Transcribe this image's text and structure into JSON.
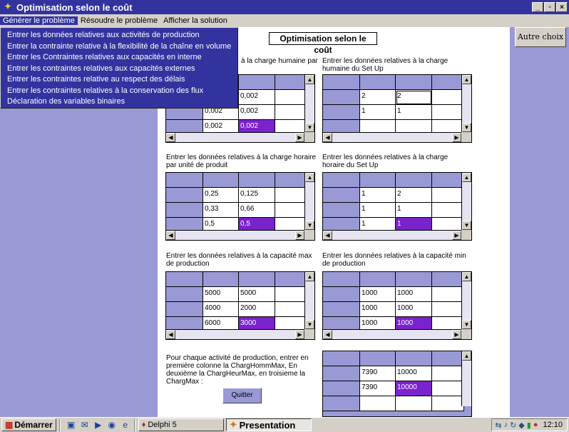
{
  "window": {
    "title": "Optimisation selon le coût"
  },
  "menu": {
    "items": [
      "Générer le problème",
      "Résoudre le problème",
      "Afficher la solution"
    ],
    "dropdown": [
      "Entrer les données relatives aux activités de production",
      "Entrer la contrainte relative à la flexibilité de la chaîne en volume",
      "Entrer les Contraintes relatives aux capacités en interne",
      "Entrer les contraintes relatives aux capacités externes",
      "Entrer les contraintes relative au respect des délais",
      "Entrer les contraintes relatives à la conservation des flux",
      "Déclaration des variables binaires"
    ]
  },
  "form": {
    "title": "Optimisation selon le coût",
    "autre_choix": "Autre choix",
    "quitter": "Quitter",
    "instructions": "Pour chaque activité de production, entrer en première colonne la ChargHommMax, En deuxième la ChargHeurMax, en troisieme la ChargMax :"
  },
  "labels": {
    "g1": "à la charge humaine par",
    "g2": "Entrer les données relatives à la charge humaine du Set Up",
    "g3": "Entrer les données relatives à la charge horaire par unité de produit",
    "g4": "Entrer les données relatives à la charge horaire du Set Up",
    "g5": "Entrer les données relatives à la capacité max de production",
    "g6": "Entrer les données relatives à la capacité min de production"
  },
  "grids": {
    "g1": {
      "r1": [
        "",
        "0,002"
      ],
      "r2": [
        "0,002",
        "0,002"
      ],
      "r3": [
        "0,002",
        "0,002"
      ]
    },
    "g2": {
      "r1": [
        "2",
        "2"
      ],
      "r2": [
        "1",
        "1"
      ],
      "r3": [
        "",
        ""
      ]
    },
    "g3": {
      "r1": [
        "0,25",
        "0,125"
      ],
      "r2": [
        "0,33",
        "0,66"
      ],
      "r3": [
        "0,5",
        "0,5"
      ]
    },
    "g4": {
      "r1": [
        "1",
        "2"
      ],
      "r2": [
        "1",
        "1"
      ],
      "r3": [
        "1",
        "1"
      ]
    },
    "g5": {
      "r1": [
        "5000",
        "5000"
      ],
      "r2": [
        "4000",
        "2000"
      ],
      "r3": [
        "6000",
        "3000"
      ]
    },
    "g6": {
      "r1": [
        "1000",
        "1000"
      ],
      "r2": [
        "1000",
        "1000"
      ],
      "r3": [
        "1000",
        "1000"
      ]
    },
    "g7": {
      "r1": [
        "7390",
        "10000"
      ],
      "r2": [
        "7390",
        "10000"
      ]
    }
  },
  "taskbar": {
    "start": "Démarrer",
    "tasks": [
      "Delphi 5",
      "Presentation"
    ],
    "clock": "12:10"
  },
  "colors": {
    "background": "#9999d6",
    "selection": "#7a22cc",
    "title": "#3333a0"
  }
}
